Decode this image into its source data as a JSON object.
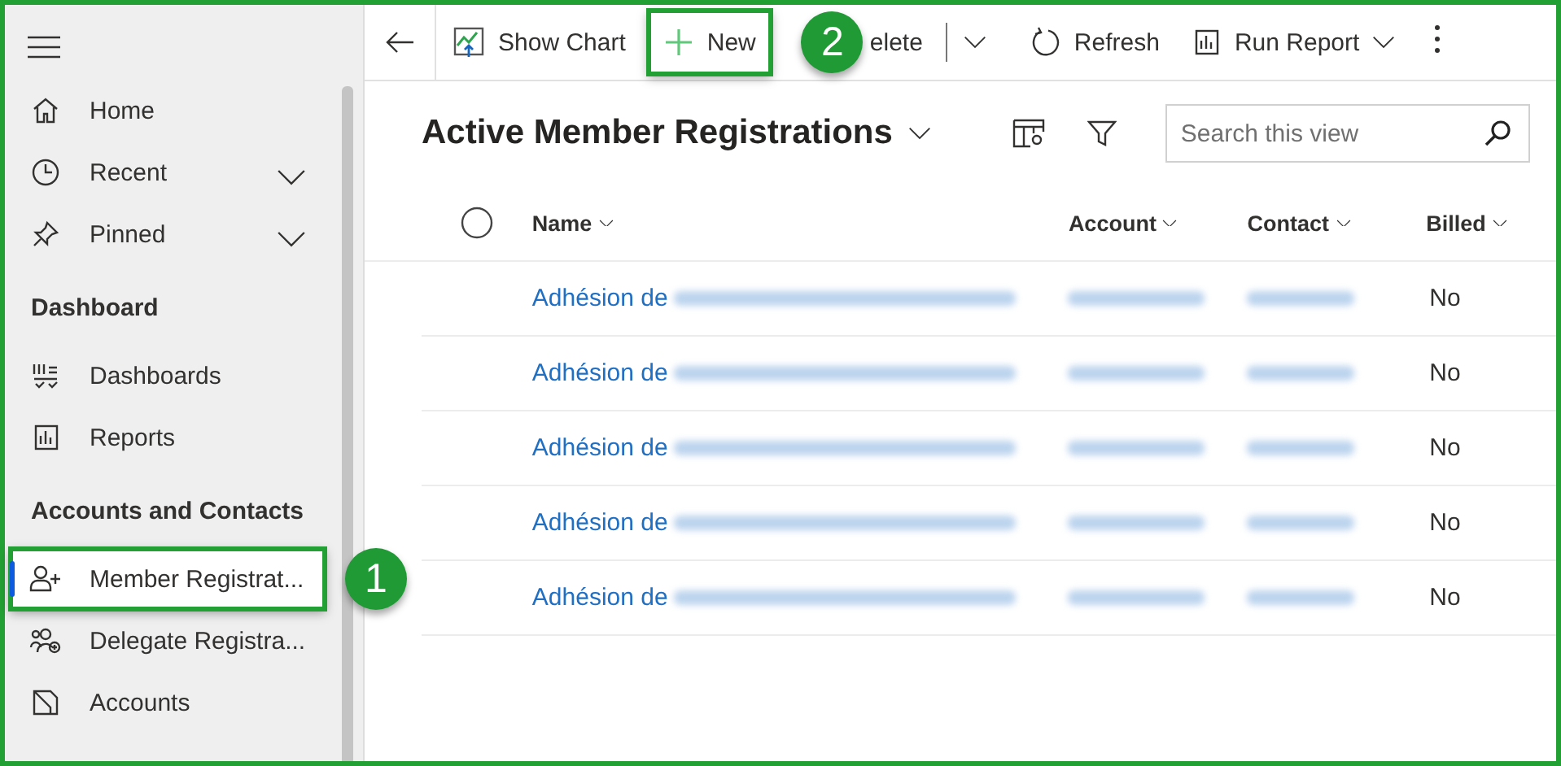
{
  "sidebar": {
    "items": [
      {
        "kind": "item",
        "label": "Home",
        "expandable": false,
        "selected": false
      },
      {
        "kind": "item",
        "label": "Recent",
        "expandable": true,
        "selected": false
      },
      {
        "kind": "item",
        "label": "Pinned",
        "expandable": true,
        "selected": false
      },
      {
        "kind": "heading",
        "label": "Dashboard"
      },
      {
        "kind": "item",
        "label": "Dashboards",
        "expandable": false,
        "selected": false
      },
      {
        "kind": "item",
        "label": "Reports",
        "expandable": false,
        "selected": false
      },
      {
        "kind": "heading",
        "label": "Accounts and Contacts"
      },
      {
        "kind": "item",
        "label": "Member Registrat...",
        "expandable": false,
        "selected": true,
        "highlighted": true,
        "callout": "1"
      },
      {
        "kind": "item",
        "label": "Delegate Registra...",
        "expandable": false,
        "selected": false
      },
      {
        "kind": "item",
        "label": "Accounts",
        "expandable": false,
        "selected": false
      }
    ]
  },
  "command_bar": {
    "buttons": [
      {
        "kind": "back"
      },
      {
        "kind": "button",
        "label": "Show Chart"
      },
      {
        "kind": "button",
        "label": "New",
        "highlighted": true,
        "callout": "2"
      },
      {
        "kind": "button",
        "label": "elete"
      },
      {
        "kind": "split"
      },
      {
        "kind": "button",
        "label": "Refresh"
      },
      {
        "kind": "button",
        "label": "Run Report",
        "dropdown": true
      },
      {
        "kind": "more"
      }
    ]
  },
  "view": {
    "title": "Active Member Registrations",
    "search": {
      "placeholder": "Search this view"
    }
  },
  "table": {
    "select_all": {
      "checked": false
    },
    "columns": [
      "Name",
      "Account",
      "Contact",
      "Billed"
    ],
    "rows": [
      {
        "name": "Adhésion de",
        "billed": "No"
      },
      {
        "name": "Adhésion de",
        "billed": "No"
      },
      {
        "name": "Adhésion de",
        "billed": "No"
      },
      {
        "name": "Adhésion de",
        "billed": "No"
      },
      {
        "name": "Adhésion de",
        "billed": "No"
      }
    ]
  }
}
